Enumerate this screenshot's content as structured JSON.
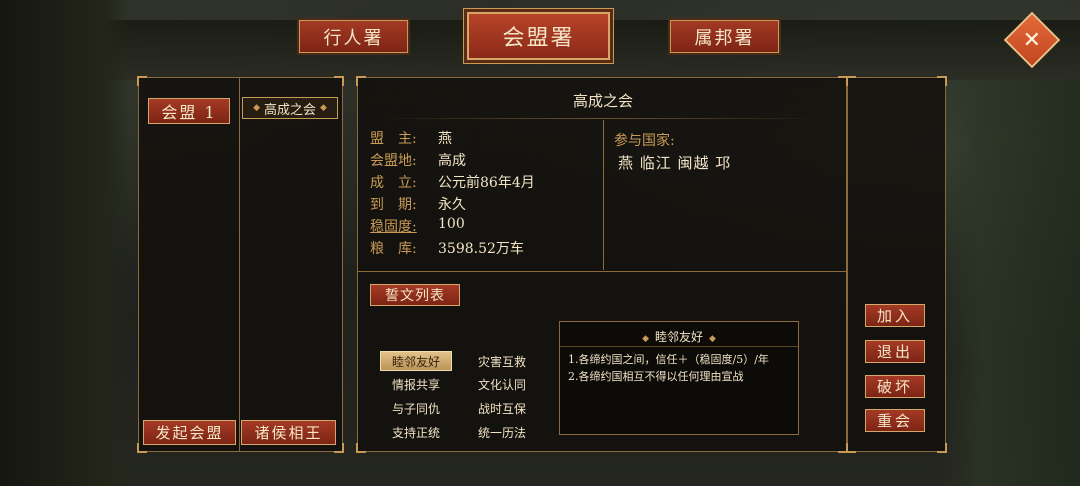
{
  "tabs": [
    {
      "label": "行人署",
      "active": false
    },
    {
      "label": "会盟署",
      "active": true
    },
    {
      "label": "属邦署",
      "active": false
    }
  ],
  "close_icon": "close-icon",
  "left_panel": {
    "alliance_tab": "会盟 1",
    "alliance_item": "高成之会",
    "initiate_label": "发起会盟",
    "lord_label": "诸侯相王"
  },
  "alliance": {
    "name": "高成之会",
    "rows": [
      {
        "label": "盟　主:",
        "value": "燕"
      },
      {
        "label": "会盟地:",
        "value": "高成"
      },
      {
        "label": "成　立:",
        "value": "公元前86年4月"
      },
      {
        "label": "到　期:",
        "value": "永久"
      },
      {
        "label": "稳固度:",
        "value": "100"
      },
      {
        "label": "粮　库:",
        "value": "3598.52万车"
      }
    ],
    "countries_label": "参与国家:",
    "countries": "燕 临江 闽越 邛"
  },
  "oaths": {
    "list_label": "誓文列表",
    "items": [
      {
        "label": "睦邻友好",
        "selected": true
      },
      {
        "label": "灾害互救",
        "selected": false
      },
      {
        "label": "情报共享",
        "selected": false
      },
      {
        "label": "文化认同",
        "selected": false
      },
      {
        "label": "与子同仇",
        "selected": false
      },
      {
        "label": "战时互保",
        "selected": false
      },
      {
        "label": "支持正统",
        "selected": false
      },
      {
        "label": "统一历法",
        "selected": false
      }
    ],
    "detail": {
      "title": "睦邻友好",
      "lines": [
        "1.各缔约国之间，信任＋（稳固度/5）/年",
        "2.各缔约国相互不得以任何理由宣战"
      ]
    }
  },
  "actions": {
    "join": "加入",
    "leave": "退出",
    "break": "破坏",
    "reconvene": "重会"
  },
  "colors": {
    "accent_red": "#a43a24",
    "gold": "#c99a55",
    "panel_bg": "#12100c",
    "text": "#f1e3c4"
  }
}
